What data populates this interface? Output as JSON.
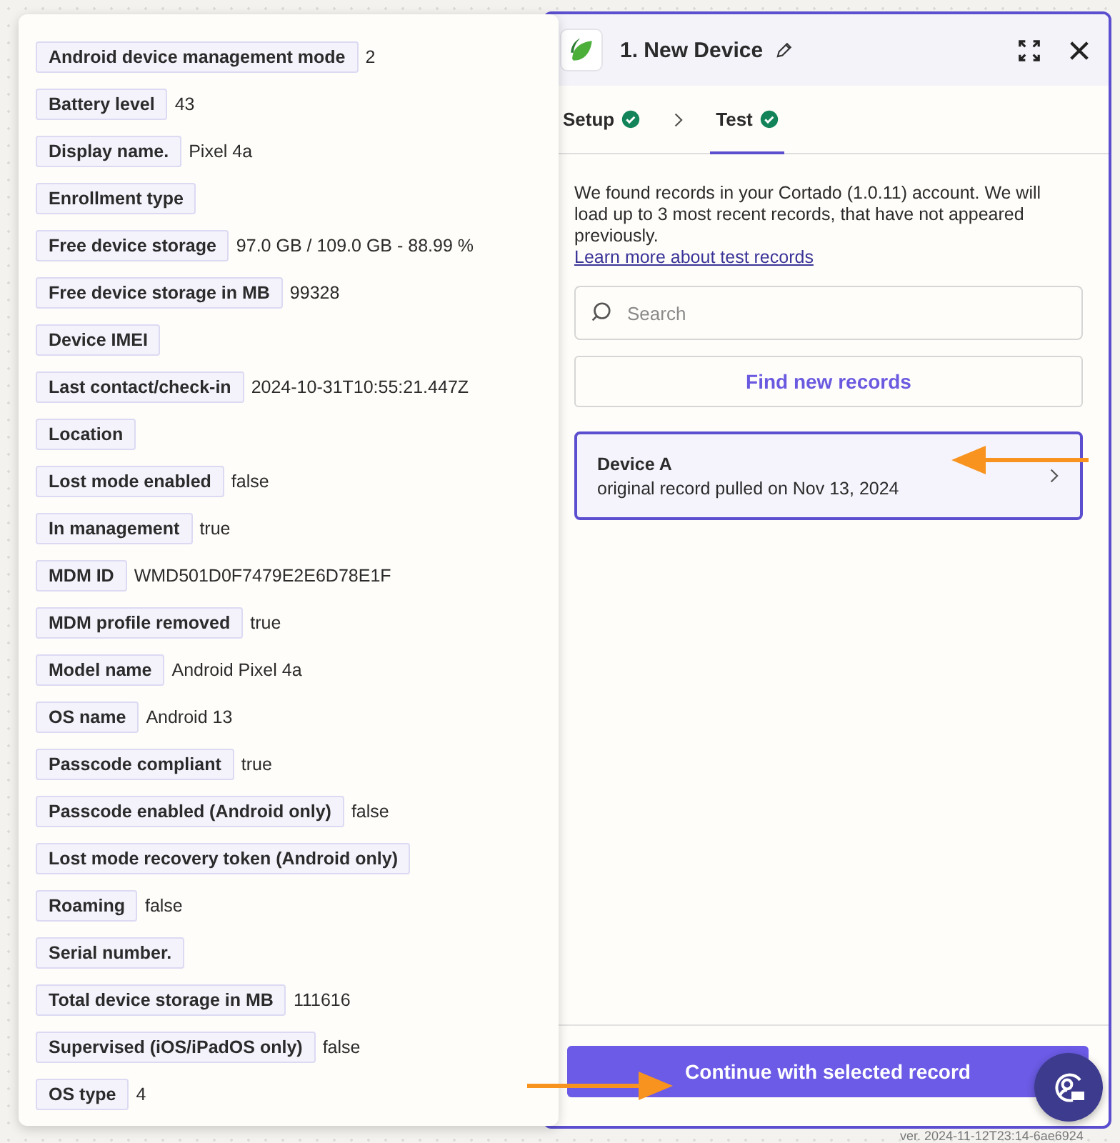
{
  "fields_popover": {
    "rows": [
      {
        "label": "Android device management mode",
        "value": "2"
      },
      {
        "label": "Battery level",
        "value": "43"
      },
      {
        "label": "Display name.",
        "value": "Pixel 4a"
      },
      {
        "label": "Enrollment type"
      },
      {
        "label": "Free device storage",
        "value": "97.0 GB / 109.0 GB - 88.99 %"
      },
      {
        "label": "Free device storage in MB",
        "value": "99328"
      },
      {
        "label": "Device IMEI"
      },
      {
        "label": "Last contact/check-in",
        "value": "2024-10-31T10:55:21.447Z"
      },
      {
        "label": "Location"
      },
      {
        "label": "Lost mode enabled",
        "value": "false"
      },
      {
        "label": "In management",
        "value": "true"
      },
      {
        "label": "MDM ID",
        "value": "WMD501D0F7479E2E6D78E1F"
      },
      {
        "label": "MDM profile removed",
        "value": "true"
      },
      {
        "label": "Model name",
        "value": "Android Pixel 4a"
      },
      {
        "label": "OS name",
        "value": "Android 13"
      },
      {
        "label": "Passcode compliant",
        "value": "true"
      },
      {
        "label": "Passcode enabled (Android only)",
        "value": "false"
      },
      {
        "label": "Lost mode recovery token (Android only)"
      },
      {
        "label": "Roaming",
        "value": "false"
      },
      {
        "label": "Serial number."
      },
      {
        "label": "Total device storage in MB",
        "value": "111616"
      },
      {
        "label": "Supervised (iOS/iPadOS only)",
        "value": "false"
      },
      {
        "label": "OS type",
        "value": "4"
      }
    ]
  },
  "step_panel": {
    "title": "1. New Device",
    "tabs": [
      {
        "label": "Setup",
        "selected": false,
        "done": true
      },
      {
        "label": "Test",
        "selected": true,
        "done": true
      }
    ],
    "description": "We found records in your Cortado (1.0.11) account. We will load up to 3 most recent records, that have not appeared previously.",
    "link": "Learn more about test records",
    "search": {
      "placeholder": "Search"
    },
    "find_button": "Find new records",
    "records": [
      {
        "title": "Device A",
        "subtitle": "original record pulled on Nov 13, 2024",
        "selected": true
      }
    ],
    "continue_button": "Continue with selected record"
  },
  "version": "ver. 2024-11-12T23:14-6ae6924"
}
